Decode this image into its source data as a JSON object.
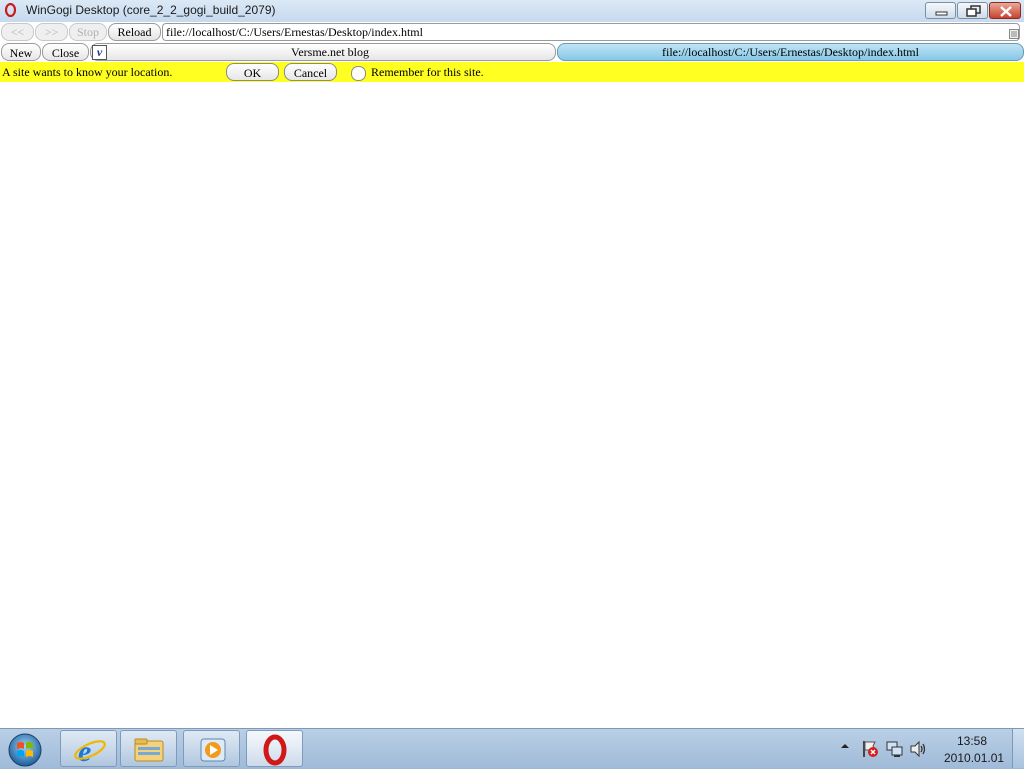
{
  "window": {
    "title": "WinGogi Desktop (core_2_2_gogi_build_2079)",
    "icons": {
      "app": "opera-icon",
      "minimize": "minimize-icon",
      "maximize": "restore-icon",
      "close": "close-icon"
    }
  },
  "toolbar": {
    "back_label": "<<",
    "forward_label": ">>",
    "stop_label": "Stop",
    "reload_label": "Reload",
    "address_value": "file://localhost/C:/Users/Ernestas/Desktop/index.html"
  },
  "tabbar": {
    "new_label": "New",
    "close_label": "Close",
    "tabs": [
      {
        "label": "Versme.net blog",
        "favicon": "v-logo-icon",
        "active": false
      },
      {
        "label": "file://localhost/C:/Users/Ernestas/Desktop/index.html",
        "active": true
      }
    ]
  },
  "notification": {
    "message": "A site wants to know your location.",
    "ok_label": "OK",
    "cancel_label": "Cancel",
    "remember_label": "Remember for this site.",
    "remember_checked": false,
    "background": "#ffff22"
  },
  "taskbar": {
    "apps": [
      {
        "name": "internet-explorer-icon"
      },
      {
        "name": "file-explorer-icon"
      },
      {
        "name": "media-player-icon"
      },
      {
        "name": "opera-icon",
        "active": true
      }
    ],
    "tray": [
      "show-hidden-icons-icon",
      "action-center-icon",
      "network-icon",
      "volume-icon"
    ],
    "clock_time": "13:58",
    "clock_date": "2010.01.01"
  }
}
